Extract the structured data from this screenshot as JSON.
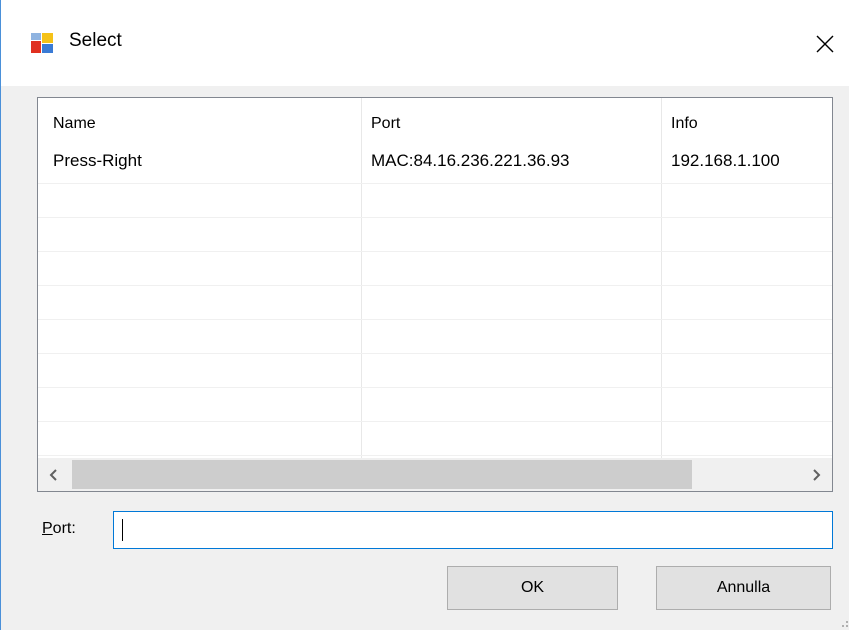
{
  "window": {
    "title": "Select",
    "accent_border": "#4a90d9"
  },
  "list": {
    "columns": [
      {
        "label": "Name"
      },
      {
        "label": "Port"
      },
      {
        "label": "Info"
      }
    ],
    "rows": [
      {
        "name": "Press-Right",
        "port": "MAC:84.16.236.221.36.93",
        "info": "192.168.1.100"
      }
    ]
  },
  "port_field": {
    "label_mnemonic": "P",
    "label_rest": "ort:",
    "value": ""
  },
  "buttons": {
    "ok": "OK",
    "cancel": "Annulla"
  },
  "icons": {
    "app": "app-window-icon",
    "close": "close-icon",
    "scroll_left": "chevron-left-icon",
    "scroll_right": "chevron-right-icon",
    "grip": "resize-grip-icon"
  }
}
